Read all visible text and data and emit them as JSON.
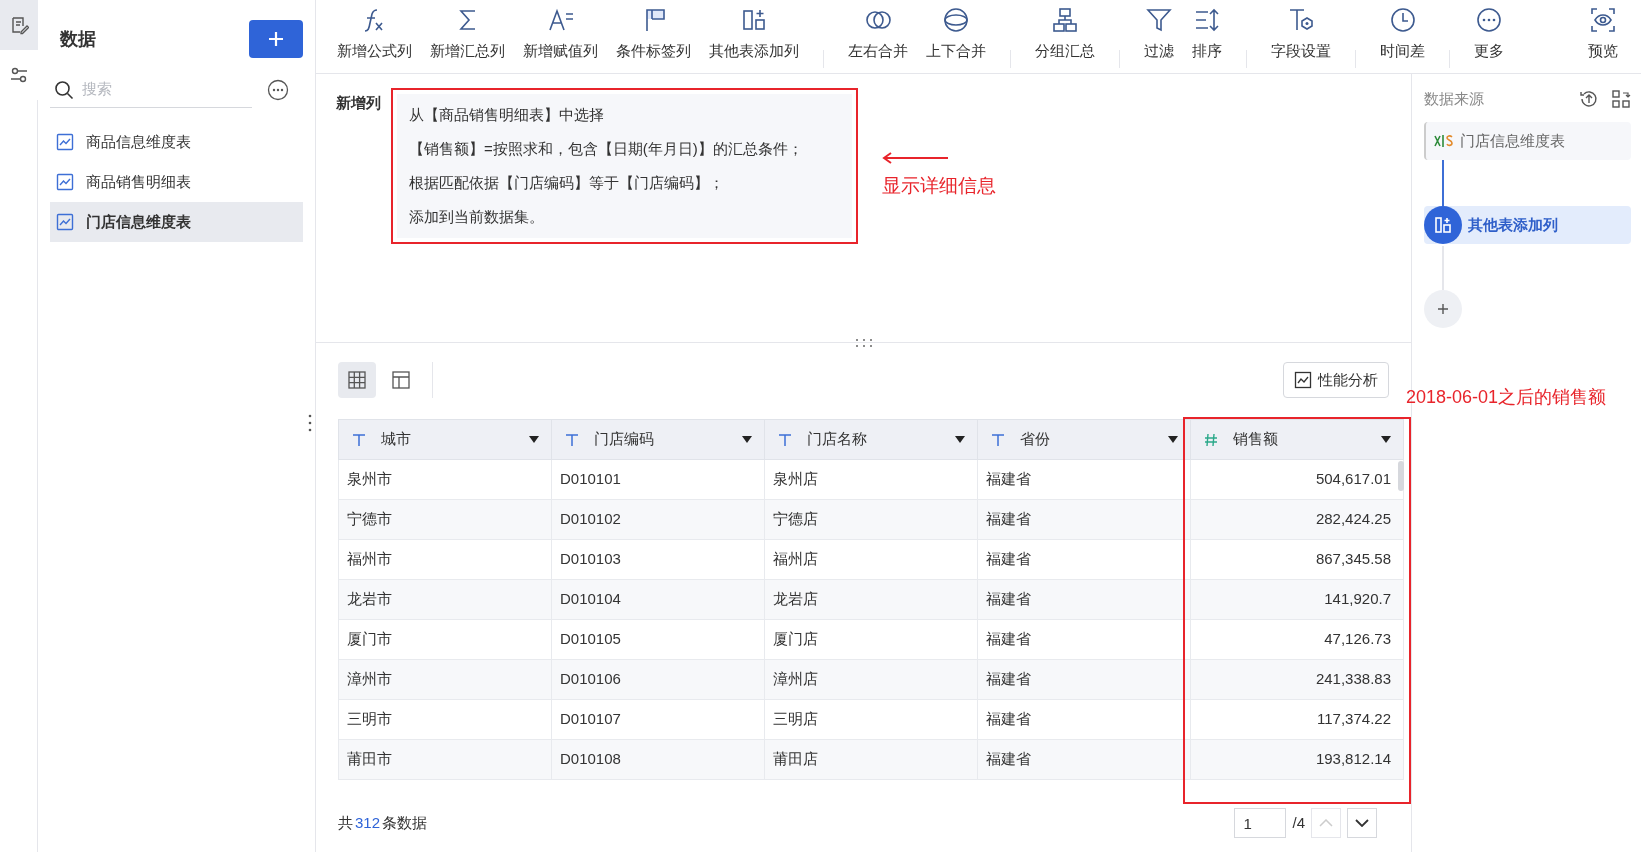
{
  "rail": [
    {
      "selected": true
    },
    {
      "selected": false
    }
  ],
  "sidebar": {
    "title": "数据",
    "search": {
      "placeholder": "搜索"
    },
    "items": [
      {
        "label": "商品信息维度表",
        "selected": false
      },
      {
        "label": "商品销售明细表",
        "selected": false
      },
      {
        "label": "门店信息维度表",
        "selected": true
      }
    ]
  },
  "toolbar": [
    [
      "新增公式列",
      "新增汇总列",
      "新增赋值列",
      "条件标签列",
      "其他表添加列"
    ],
    [
      "左右合并",
      "上下合并"
    ],
    [
      "分组汇总"
    ],
    [
      "过滤",
      "排序"
    ],
    [
      "字段设置"
    ],
    [
      "时间差"
    ],
    [
      "更多",
      "预览"
    ]
  ],
  "details": {
    "label": "新增列",
    "lines": [
      "从【商品销售明细表】中选择",
      "【销售额】=按照求和，包含【日期(年月日)】的汇总条件；",
      "根据匹配依据【门店编码】等于【门店编码】；",
      "添加到当前数据集。"
    ]
  },
  "annotations": [
    "显示详细信息",
    "2018-06-01之后的销售额"
  ],
  "view_toggle": [
    {
      "selected": true
    },
    {
      "selected": false
    }
  ],
  "perf_button": "性能分析",
  "table": {
    "columns": [
      {
        "label": "城市",
        "kind": "text"
      },
      {
        "label": "门店编码",
        "kind": "text"
      },
      {
        "label": "门店名称",
        "kind": "text"
      },
      {
        "label": "省份",
        "kind": "text"
      },
      {
        "label": "销售额",
        "kind": "number"
      }
    ],
    "rows": [
      [
        "泉州市",
        "D010101",
        "泉州店",
        "福建省",
        "504,617.01"
      ],
      [
        "宁德市",
        "D010102",
        "宁德店",
        "福建省",
        "282,424.25"
      ],
      [
        "福州市",
        "D010103",
        "福州店",
        "福建省",
        "867,345.58"
      ],
      [
        "龙岩市",
        "D010104",
        "龙岩店",
        "福建省",
        "141,920.7"
      ],
      [
        "厦门市",
        "D010105",
        "厦门店",
        "福建省",
        "47,126.73"
      ],
      [
        "漳州市",
        "D010106",
        "漳州店",
        "福建省",
        "241,338.83"
      ],
      [
        "三明市",
        "D010107",
        "三明店",
        "福建省",
        "117,374.22"
      ],
      [
        "莆田市",
        "D010108",
        "莆田店",
        "福建省",
        "193,812.14"
      ]
    ]
  },
  "footer": {
    "prefix": "共",
    "count": "312",
    "suffix": "条数据",
    "page": "1",
    "pages": "/4"
  },
  "right_panel": {
    "title": "数据来源",
    "steps": [
      {
        "label": "门店信息维度表",
        "kind": "source",
        "selected": false
      },
      {
        "label": "其他表添加列",
        "kind": "join",
        "selected": true
      }
    ]
  }
}
